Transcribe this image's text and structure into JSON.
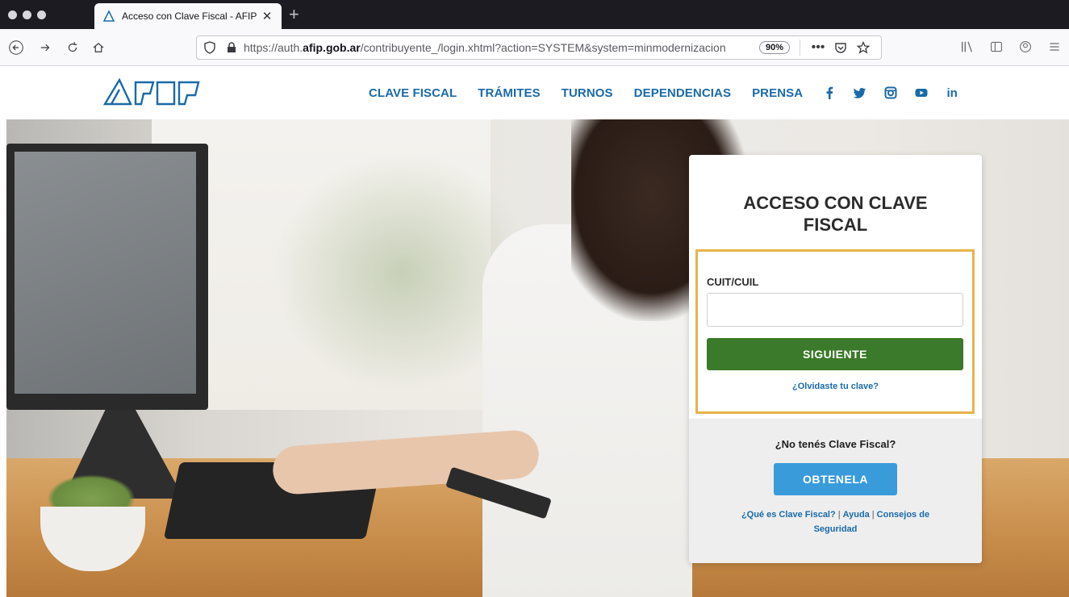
{
  "browser": {
    "tab_title": "Acceso con Clave Fiscal - AFIP",
    "tab_close": "✕",
    "new_tab": "+",
    "url_prefix": "https://auth.",
    "url_domain": "afip.gob.ar",
    "url_path": "/contribuyente_/login.xhtml?action=SYSTEM&system=minmodernizacion",
    "zoom": "90%",
    "more_actions": "•••"
  },
  "site": {
    "nav": [
      "CLAVE FISCAL",
      "TRÁMITES",
      "TURNOS",
      "DEPENDENCIAS",
      "PRENSA"
    ],
    "social_linkedin": "in"
  },
  "login": {
    "title": "ACCESO CON CLAVE FISCAL",
    "cuit_label": "CUIT/CUIL",
    "cuit_value": "",
    "next_button": "SIGUIENTE",
    "forgot_link": "¿Olvidaste tu clave?",
    "no_clave": "¿No tenés Clave Fiscal?",
    "get_button": "OBTENELA",
    "link_que_es": "¿Qué es Clave Fiscal?",
    "link_ayuda": "Ayuda",
    "link_consejos": "Consejos de Seguridad",
    "separator": "|"
  },
  "colors": {
    "nav_blue": "#1a6aa8",
    "green_button": "#3a7a2a",
    "blue_button": "#3a9bdb",
    "highlight": "#e8b34c"
  }
}
